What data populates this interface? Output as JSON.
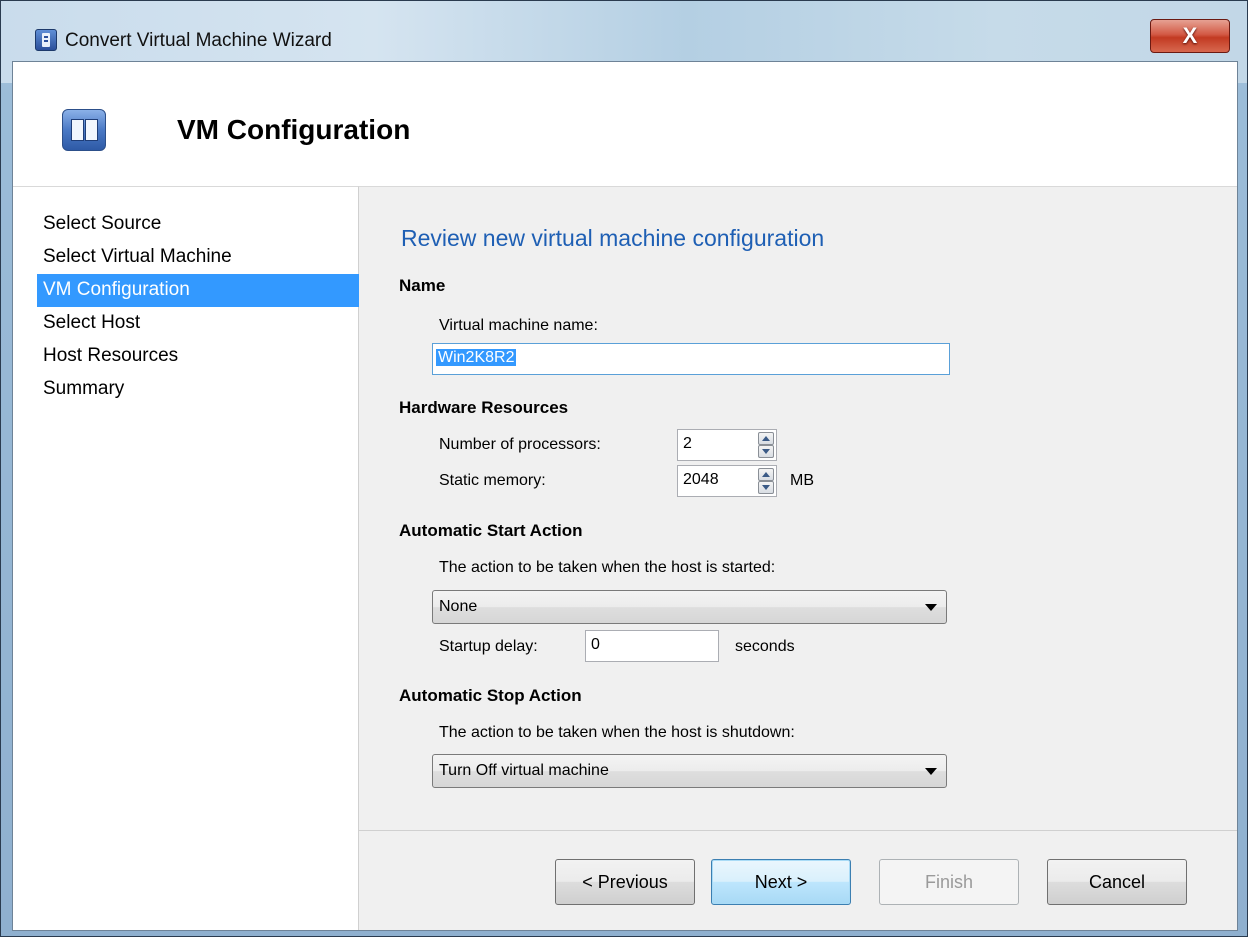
{
  "window": {
    "title": "Convert Virtual Machine Wizard",
    "close_label": "X"
  },
  "header": {
    "title": "VM Configuration"
  },
  "nav": {
    "items": [
      {
        "label": "Select Source"
      },
      {
        "label": "Select Virtual Machine"
      },
      {
        "label": "VM Configuration",
        "active": true
      },
      {
        "label": "Select Host"
      },
      {
        "label": "Host Resources"
      },
      {
        "label": "Summary"
      }
    ]
  },
  "main": {
    "section_title": "Review new virtual machine configuration",
    "name_group": {
      "heading": "Name",
      "vm_name_label": "Virtual machine name:",
      "vm_name_value": "Win2K8R2"
    },
    "hardware_group": {
      "heading": "Hardware Resources",
      "processors_label": "Number of processors:",
      "processors_value": "2",
      "memory_label": "Static memory:",
      "memory_value": "2048",
      "memory_unit": "MB"
    },
    "start_group": {
      "heading": "Automatic Start Action",
      "description": "The action to be taken when the host is started:",
      "selected": "None",
      "delay_label": "Startup delay:",
      "delay_value": "0",
      "delay_unit": "seconds"
    },
    "stop_group": {
      "heading": "Automatic Stop Action",
      "description": "The action to be taken when the host is shutdown:",
      "selected": "Turn Off virtual machine"
    }
  },
  "footer": {
    "previous_label": "< Previous",
    "next_label": "Next >",
    "finish_label": "Finish",
    "cancel_label": "Cancel"
  },
  "colors": {
    "accent": "#3399ff",
    "section_title": "#1e5fb4",
    "close": "#c23a22"
  }
}
